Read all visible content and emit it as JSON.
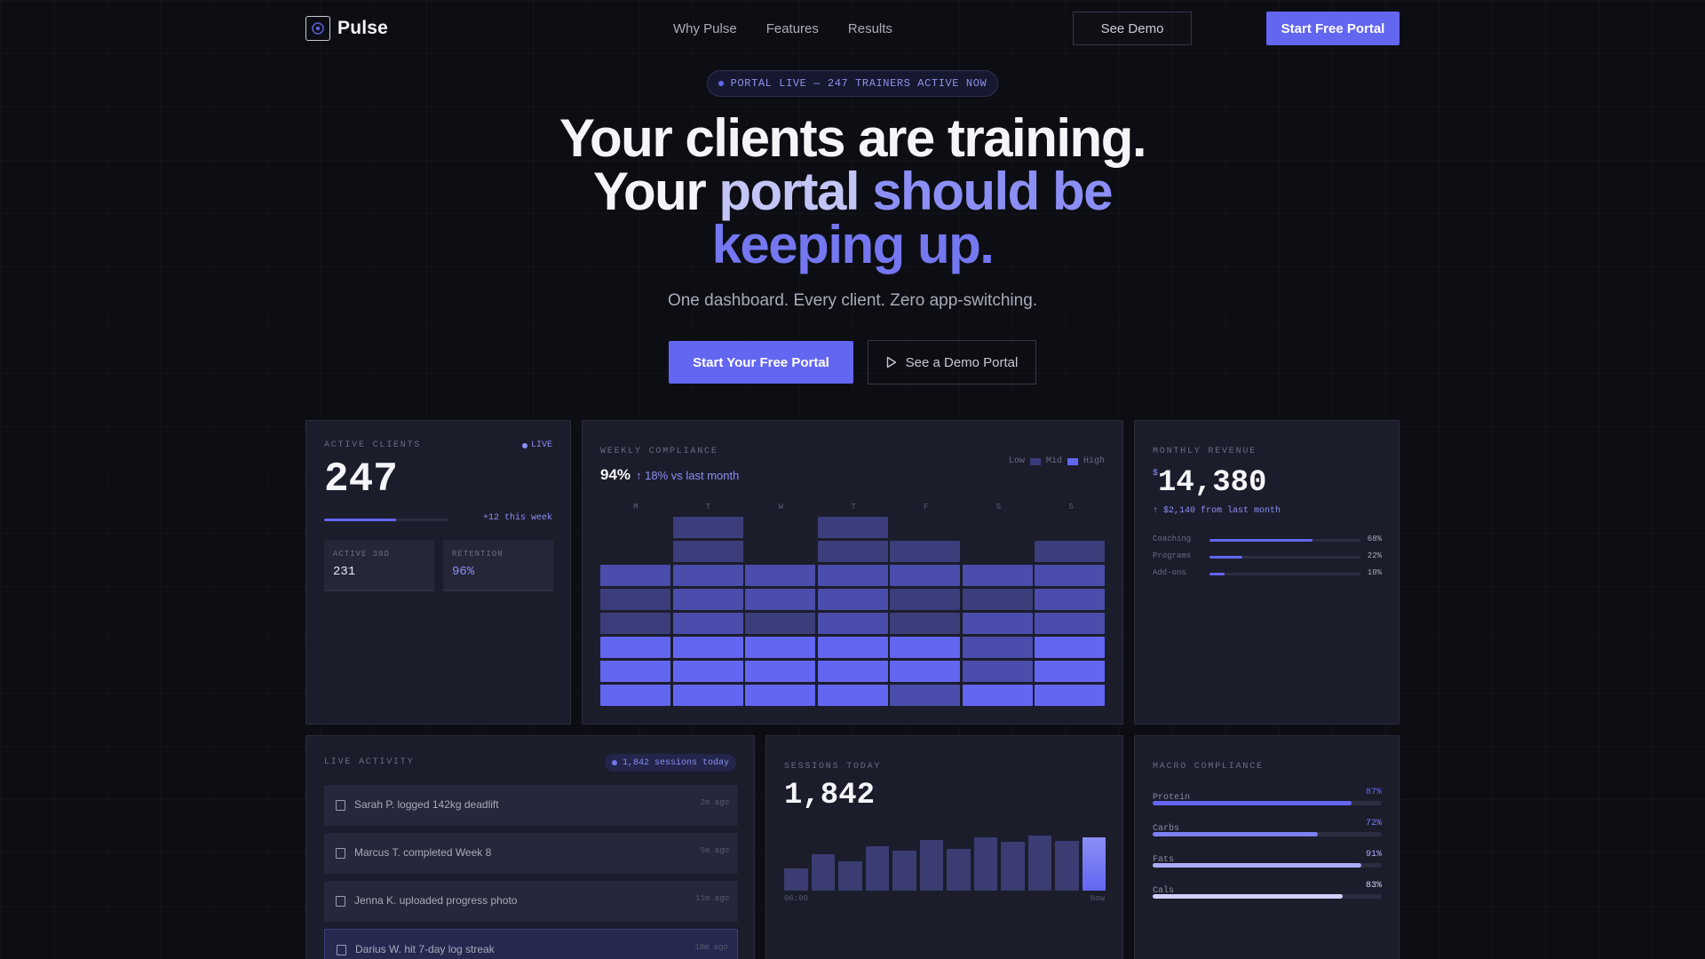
{
  "nav": {
    "brand": "Pulse",
    "links": [
      "Why Pulse",
      "Features",
      "Results"
    ],
    "demo_label": "See Demo",
    "start_label": "Start Free Portal"
  },
  "hero": {
    "pill": "PORTAL LIVE — 247 TRAINERS ACTIVE NOW",
    "line1": "Your clients are training.",
    "line2_a": "Your ",
    "line2_b": "portal ",
    "line2_c": "should be",
    "line3": "keeping up.",
    "subtitle": "One dashboard. Every client. Zero app-switching.",
    "cta_primary": "Start Your Free Portal",
    "cta_secondary": "See a Demo Portal"
  },
  "colors": {
    "accent": "#6366f1",
    "accent_light": "#8b8ff5",
    "background": "#0d0e14",
    "card": "#1c1d2b"
  },
  "active_clients": {
    "label": "ACTIVE CLIENTS",
    "live": "LIVE",
    "value": "247",
    "progress": 0.58,
    "delta": "+12 this week",
    "stats": [
      {
        "label": "ACTIVE 30D",
        "value": "231"
      },
      {
        "label": "RETENTION",
        "value": "96%"
      }
    ]
  },
  "weekly_compliance": {
    "label": "WEEKLY COMPLIANCE",
    "value": "94%",
    "delta": "↑ 18% vs last month",
    "legend": [
      "Low",
      "Mid",
      "High"
    ],
    "days": [
      "M",
      "T",
      "W",
      "T",
      "F",
      "S",
      "S"
    ],
    "levels_top_to_bottom": [
      [
        0,
        1,
        0,
        1,
        0,
        0,
        0
      ],
      [
        0,
        1,
        0,
        1,
        1,
        0,
        1
      ],
      [
        2,
        2,
        2,
        2,
        2,
        2,
        2
      ],
      [
        1,
        2,
        2,
        2,
        1,
        1,
        2
      ],
      [
        1,
        2,
        1,
        2,
        1,
        2,
        2
      ],
      [
        3,
        3,
        3,
        3,
        3,
        2,
        3
      ],
      [
        3,
        3,
        3,
        3,
        3,
        2,
        3
      ],
      [
        3,
        3,
        3,
        3,
        2,
        3,
        3
      ]
    ]
  },
  "monthly_revenue": {
    "label": "MONTHLY REVENUE",
    "currency": "$",
    "value": "14,380",
    "delta": "↑ $2,140 from last month",
    "rows": [
      {
        "name": "Coaching",
        "pct": "68%",
        "value": 0.68
      },
      {
        "name": "Programs",
        "pct": "22%",
        "value": 0.22
      },
      {
        "name": "Add-ons",
        "pct": "10%",
        "value": 0.1
      }
    ]
  },
  "live_activity": {
    "label": "LIVE ACTIVITY",
    "sessions_pill": "1,842 sessions today",
    "items": [
      {
        "text": "Sarah P. logged 142kg deadlift",
        "time": "2m ago"
      },
      {
        "text": "Marcus T. completed Week 8",
        "time": "5m ago"
      },
      {
        "text": "Jenna K. uploaded progress photo",
        "time": "11m ago"
      },
      {
        "text": "Darius W. hit 7-day log streak",
        "time": "18m ago"
      }
    ]
  },
  "sessions_today": {
    "label": "SESSIONS TODAY",
    "value": "1,842",
    "axis_start": "06:00",
    "axis_end": "Now",
    "bars": [
      0.4,
      0.66,
      0.54,
      0.8,
      0.72,
      0.92,
      0.76,
      0.96,
      0.88,
      1.0,
      0.9,
      0.96
    ]
  },
  "macro_compliance": {
    "label": "MACRO COMPLIANCE",
    "rows": [
      {
        "name": "Protein",
        "pct": "87%",
        "value": 0.87,
        "color": "#6366f1"
      },
      {
        "name": "Carbs",
        "pct": "72%",
        "value": 0.72,
        "color": "#7c80f3"
      },
      {
        "name": "Fats",
        "pct": "91%",
        "value": 0.91,
        "color": "#a9acf7"
      },
      {
        "name": "Cals",
        "pct": "83%",
        "value": 0.83,
        "color": "#cfd1fb"
      }
    ]
  }
}
